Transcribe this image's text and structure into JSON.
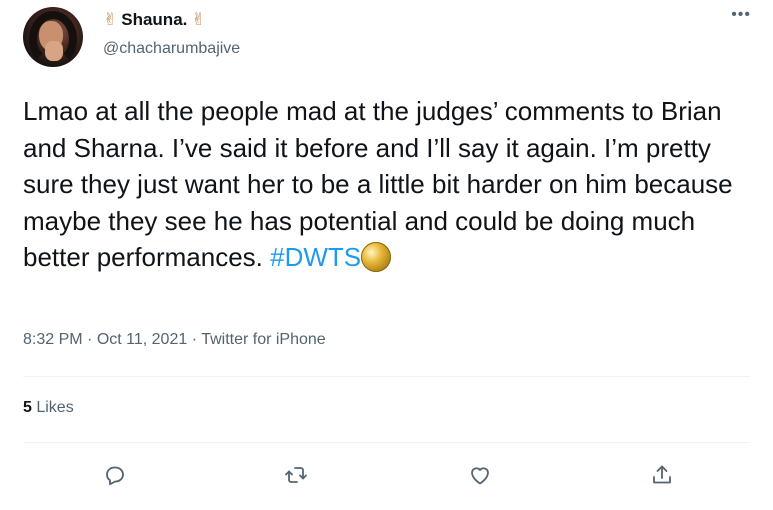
{
  "user": {
    "display_name": "Shauna.",
    "emoji_left": "✌",
    "emoji_right": "✌",
    "handle": "@chacharumbajive"
  },
  "menu": {
    "more_label": "•••"
  },
  "tweet": {
    "text": "Lmao at all the people mad at the judges’ comments to Brian and Sharna. I’ve said it before and I’ll say it again. I’m pretty sure they just want her to be a little bit harder on him because maybe they see he has potential and could be doing much better performances. ",
    "hashtag": "#DWTS",
    "emoji_icon": "mirrorball-icon"
  },
  "meta": {
    "time": "8:32 PM",
    "separator1": " · ",
    "date": "Oct 11, 2021",
    "separator2": " · ",
    "source": "Twitter for iPhone"
  },
  "stats": {
    "likes_count": "5",
    "likes_label": " Likes"
  },
  "actions": [
    {
      "name": "reply",
      "icon": "reply-icon"
    },
    {
      "name": "retweet",
      "icon": "retweet-icon"
    },
    {
      "name": "like",
      "icon": "heart-icon"
    },
    {
      "name": "share",
      "icon": "share-icon"
    }
  ],
  "colors": {
    "hashtag": "#1d9bf0",
    "secondary_text": "#536471",
    "primary_text": "#0f1419",
    "divider": "#eff3f4"
  }
}
